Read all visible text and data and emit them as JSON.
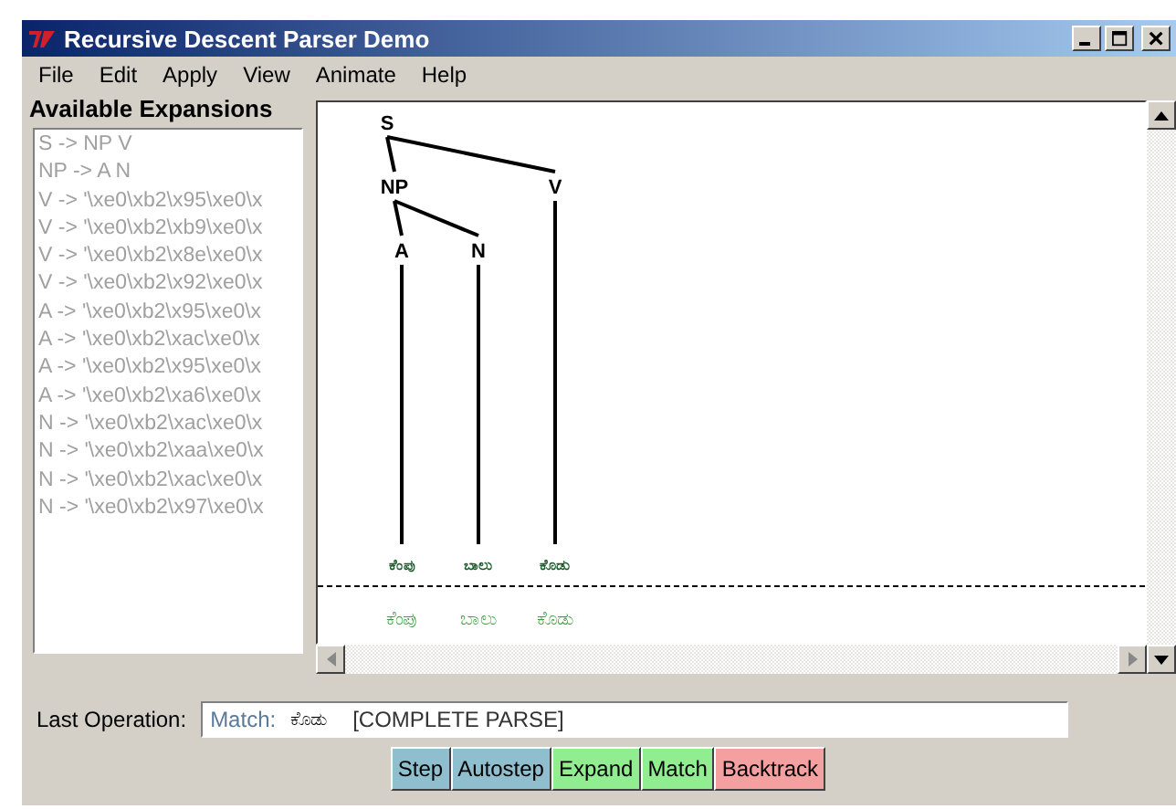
{
  "window": {
    "title": "Recursive Descent Parser Demo"
  },
  "menu": [
    {
      "label": "File"
    },
    {
      "label": "Edit"
    },
    {
      "label": "Apply"
    },
    {
      "label": "View"
    },
    {
      "label": "Animate"
    },
    {
      "label": "Help"
    }
  ],
  "expansions": {
    "title": "Available Expansions",
    "items": [
      "S -> NP V",
      "NP -> A N",
      "V -> '\\xe0\\xb2\\x95\\xe0\\x",
      "V -> '\\xe0\\xb2\\xb9\\xe0\\x",
      "V -> '\\xe0\\xb2\\x8e\\xe0\\x",
      "V -> '\\xe0\\xb2\\x92\\xe0\\x",
      "A -> '\\xe0\\xb2\\x95\\xe0\\x",
      "A -> '\\xe0\\xb2\\xac\\xe0\\x",
      "A -> '\\xe0\\xb2\\x95\\xe0\\x",
      "A -> '\\xe0\\xb2\\xa6\\xe0\\x",
      "N -> '\\xe0\\xb2\\xac\\xe0\\x",
      "N -> '\\xe0\\xb2\\xaa\\xe0\\x",
      "N -> '\\xe0\\xb2\\xac\\xe0\\x",
      "N -> '\\xe0\\xb2\\x97\\xe0\\x"
    ]
  },
  "tree": {
    "label": "S",
    "children": [
      {
        "label": "NP",
        "children": [
          {
            "label": "A",
            "children": [
              {
                "label": "ಕೆಂಪು"
              }
            ]
          },
          {
            "label": "N",
            "children": [
              {
                "label": "ಬಾಲು"
              }
            ]
          }
        ]
      },
      {
        "label": "V",
        "children": [
          {
            "label": "ಕೊಡು"
          }
        ]
      }
    ]
  },
  "text_tokens": [
    "ಕೆಂಪು",
    "ಬಾಲು",
    "ಕೊಡು"
  ],
  "last_operation": {
    "label": "Last Operation:",
    "operation": "Match:",
    "token": "ಕೊಡು",
    "status": "[COMPLETE PARSE]"
  },
  "buttons": [
    {
      "label": "Step",
      "color": "#8fbfcf"
    },
    {
      "label": "Autostep",
      "color": "#8fbfcf"
    },
    {
      "label": "Expand",
      "color": "#90ee90"
    },
    {
      "label": "Match",
      "color": "#90ee90"
    },
    {
      "label": "Backtrack",
      "color": "#f4a0a0"
    }
  ]
}
